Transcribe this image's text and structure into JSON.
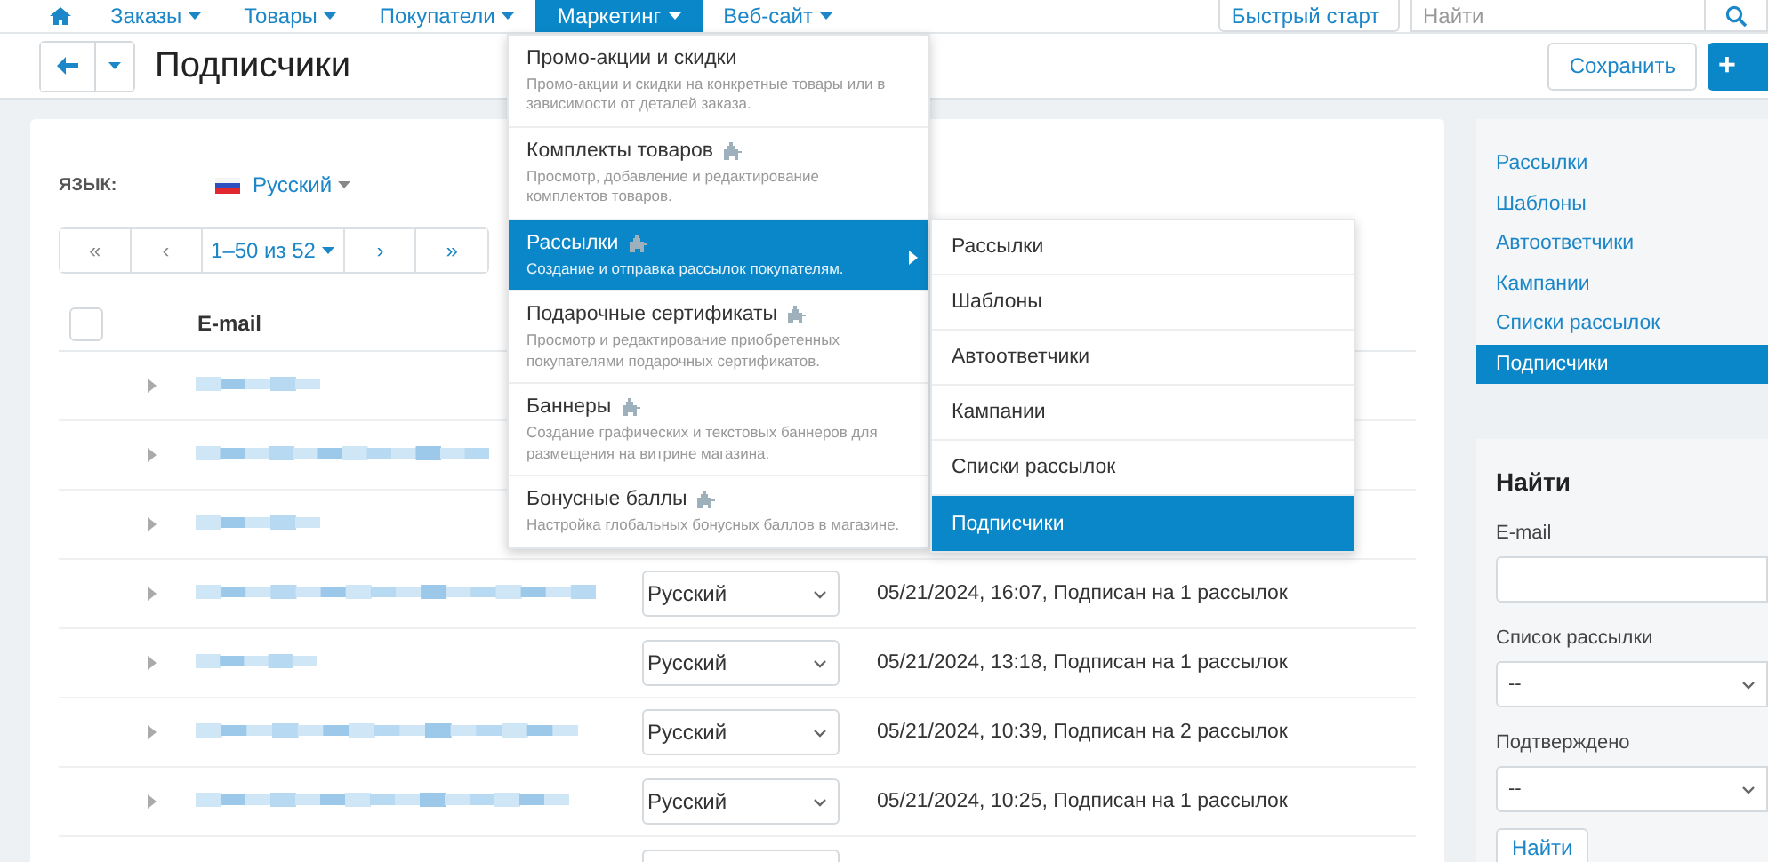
{
  "nav": {
    "items": [
      {
        "label": "Заказы",
        "selected": false
      },
      {
        "label": "Товары",
        "selected": false
      },
      {
        "label": "Покупатели",
        "selected": false
      },
      {
        "label": "Маркетинг",
        "selected": true
      },
      {
        "label": "Веб-сайт",
        "selected": false
      }
    ],
    "quick_start": "Быстрый старт",
    "search": {
      "placeholder": "Найти"
    }
  },
  "header": {
    "title": "Подписчики",
    "save": "Сохранить",
    "add": "+"
  },
  "language": {
    "label": "ЯЗЫК:",
    "value": "Русский"
  },
  "pagination": {
    "first": "«",
    "prev": "‹",
    "range": "1–50 из 52",
    "next": "›",
    "last": "»"
  },
  "table": {
    "select_all": {
      "checked": false
    },
    "columns": [
      "E-mail"
    ],
    "rows": [
      {
        "kind": "covered"
      },
      {
        "kind": "covered"
      },
      {
        "kind": "covered"
      },
      {
        "kind": "full",
        "language": "Русский",
        "status": "05/21/2024, 16:07, Подписан на 1 рассылок"
      },
      {
        "kind": "full",
        "language": "Русский",
        "status": "05/21/2024, 13:18, Подписан на 1 рассылок"
      },
      {
        "kind": "full",
        "language": "Русский",
        "status": "05/21/2024, 10:39, Подписан на 2 рассылок"
      },
      {
        "kind": "full",
        "language": "Русский",
        "status": "05/21/2024, 10:25, Подписан на 1 рассылок"
      },
      {
        "kind": "partial"
      }
    ]
  },
  "menu": {
    "items": [
      {
        "title": "Промо-акции и скидки",
        "description": "Промо-акции и скидки на конкретные товары или в зависимости от деталей заказа.",
        "addon": false,
        "selected": false,
        "submenu": false
      },
      {
        "title": "Комплекты товаров",
        "description": "Просмотр, добавление и редактирование комплектов товаров.",
        "addon": true,
        "selected": false,
        "submenu": false
      },
      {
        "title": "Рассылки",
        "description": "Создание и отправка рассылок покупателям.",
        "addon": true,
        "selected": true,
        "submenu": true
      },
      {
        "title": "Подарочные сертификаты",
        "description": "Просмотр и редактирование приобретенных покупателями подарочных сертификатов.",
        "addon": true,
        "selected": false,
        "submenu": false
      },
      {
        "title": "Баннеры",
        "description": "Создание графических и текстовых баннеров для размещения на витрине магазина.",
        "addon": true,
        "selected": false,
        "submenu": false
      },
      {
        "title": "Бонусные баллы",
        "description": "Настройка глобальных бонусных баллов в магазине.",
        "addon": true,
        "selected": false,
        "submenu": false
      }
    ],
    "submenu": [
      {
        "label": "Рассылки",
        "selected": false
      },
      {
        "label": "Шаблоны",
        "selected": false
      },
      {
        "label": "Автоответчики",
        "selected": false
      },
      {
        "label": "Кампании",
        "selected": false
      },
      {
        "label": "Списки рассылок",
        "selected": false
      },
      {
        "label": "Подписчики",
        "selected": true
      }
    ]
  },
  "sidebar": {
    "links": [
      {
        "label": "Рассылки",
        "selected": false
      },
      {
        "label": "Шаблоны",
        "selected": false
      },
      {
        "label": "Автоответчики",
        "selected": false
      },
      {
        "label": "Кампании",
        "selected": false
      },
      {
        "label": "Списки рассылок",
        "selected": false
      },
      {
        "label": "Подписчики",
        "selected": true
      }
    ],
    "filter": {
      "title": "Найти",
      "fields": [
        {
          "kind": "input",
          "label": "E-mail"
        },
        {
          "kind": "select",
          "label": "Список рассылки",
          "value": "--"
        },
        {
          "kind": "select",
          "label": "Подтверждено",
          "value": "--"
        }
      ],
      "button": "Найти"
    }
  }
}
